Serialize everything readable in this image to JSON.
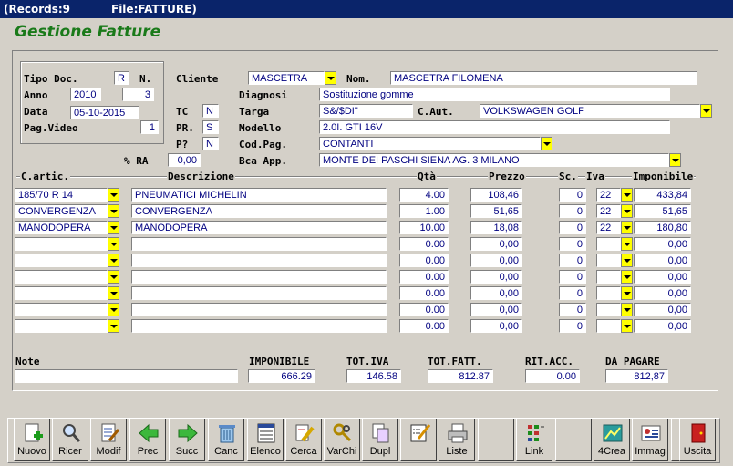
{
  "window": {
    "records": "(Records:9",
    "file": "File:FATTURE)"
  },
  "app_title": "Gestione Fatture",
  "header": {
    "tipo_doc_label": "Tipo Doc.",
    "tipo_doc": "R",
    "n_label": "N.",
    "anno_label": "Anno",
    "anno": "2010",
    "numero": "3",
    "data_label": "Data",
    "data": "05-10-2015",
    "pag_video_label": "Pag.Video",
    "pag_video": "1",
    "cliente_label": "Cliente",
    "cliente": "MASCETRA",
    "nom_label": "Nom.",
    "nominativo": "MASCETRA FILOMENA",
    "diagnosi_label": "Diagnosi",
    "diagnosi": "Sostituzione gomme",
    "tc_label": "TC",
    "tc": "N",
    "targa_label": "Targa",
    "targa": "S&/$DI\"",
    "caut_label": "C.Aut.",
    "caut": "VOLKSWAGEN GOLF",
    "pr_label": "PR.",
    "pr": "S",
    "modello_label": "Modello",
    "modello": "2.0I. GTI 16V",
    "p_label": "P?",
    "p": "N",
    "codpag_label": "Cod.Pag.",
    "codpag": "CONTANTI",
    "ra_label": "% RA",
    "ra": "0,00",
    "bca_label": "Bca App.",
    "bca": "MONTE DEI PASCHI SIENA  AG. 3  MILANO"
  },
  "columns": {
    "cartic": "C.artic.",
    "descr": "Descrizione",
    "qta": "Qtà",
    "prezzo": "Prezzo",
    "sc": "Sc.",
    "iva": "Iva",
    "imponibile": "Imponibile"
  },
  "rows": [
    {
      "cartic": "185/70 R  14",
      "descr": "PNEUMATICI MICHELIN",
      "qta": "4.00",
      "prezzo": "108,46",
      "sc": "0",
      "iva": "22",
      "imp": "433,84"
    },
    {
      "cartic": "CONVERGENZA",
      "descr": "CONVERGENZA",
      "qta": "1.00",
      "prezzo": "51,65",
      "sc": "0",
      "iva": "22",
      "imp": "51,65"
    },
    {
      "cartic": "MANODOPERA",
      "descr": "MANODOPERA",
      "qta": "10.00",
      "prezzo": "18,08",
      "sc": "0",
      "iva": "22",
      "imp": "180,80"
    },
    {
      "cartic": "",
      "descr": "",
      "qta": "0.00",
      "prezzo": "0,00",
      "sc": "0",
      "iva": "",
      "imp": "0,00"
    },
    {
      "cartic": "",
      "descr": "",
      "qta": "0.00",
      "prezzo": "0,00",
      "sc": "0",
      "iva": "",
      "imp": "0,00"
    },
    {
      "cartic": "",
      "descr": "",
      "qta": "0.00",
      "prezzo": "0,00",
      "sc": "0",
      "iva": "",
      "imp": "0,00"
    },
    {
      "cartic": "",
      "descr": "",
      "qta": "0.00",
      "prezzo": "0,00",
      "sc": "0",
      "iva": "",
      "imp": "0,00"
    },
    {
      "cartic": "",
      "descr": "",
      "qta": "0.00",
      "prezzo": "0,00",
      "sc": "0",
      "iva": "",
      "imp": "0,00"
    },
    {
      "cartic": "",
      "descr": "",
      "qta": "0.00",
      "prezzo": "0,00",
      "sc": "0",
      "iva": "",
      "imp": "0,00"
    }
  ],
  "totals": {
    "note_label": "Note",
    "note": "",
    "imponibile_label": "IMPONIBILE",
    "imponibile": "666.29",
    "totiva_label": "TOT.IVA",
    "totiva": "146.58",
    "totfatt_label": "TOT.FATT.",
    "totfatt": "812.87",
    "ritacc_label": "RIT.ACC.",
    "ritacc": "0.00",
    "dapagare_label": "DA PAGARE",
    "dapagare": "812,87"
  },
  "toolbar": [
    {
      "name": "nuovo",
      "label": "Nuovo",
      "icon": "new-doc-icon"
    },
    {
      "name": "ricer",
      "label": "Ricer",
      "icon": "magnifier-icon"
    },
    {
      "name": "modif",
      "label": "Modif",
      "icon": "edit-doc-icon"
    },
    {
      "name": "prec",
      "label": "Prec",
      "icon": "arrow-left-icon"
    },
    {
      "name": "succ",
      "label": "Succ",
      "icon": "arrow-right-icon"
    },
    {
      "name": "canc",
      "label": "Canc",
      "icon": "trash-icon"
    },
    {
      "name": "elenco",
      "label": "Elenco",
      "icon": "list-icon"
    },
    {
      "name": "cerca",
      "label": "Cerca",
      "icon": "search-brush-icon"
    },
    {
      "name": "varchi",
      "label": "VarChi",
      "icon": "keys-icon"
    },
    {
      "name": "dupl",
      "label": "Dupl",
      "icon": "duplicate-icon"
    },
    {
      "name": "pencil",
      "label": "",
      "icon": "pencil-doc-icon"
    },
    {
      "name": "liste",
      "label": "Liste",
      "icon": "printer-icon"
    },
    {
      "name": "blank1",
      "label": "",
      "icon": ""
    },
    {
      "name": "link",
      "label": "Link",
      "icon": "link-icon"
    },
    {
      "name": "blank2",
      "label": "",
      "icon": ""
    },
    {
      "name": "4crea",
      "label": "4Crea",
      "icon": "create-icon"
    },
    {
      "name": "immag",
      "label": "Immag",
      "icon": "image-icon"
    },
    {
      "name": "blank3",
      "label": "",
      "icon": ""
    },
    {
      "name": "uscita",
      "label": "Uscita",
      "icon": "exit-door-icon"
    }
  ],
  "colors": {
    "title_green": "#1a7a1a",
    "dropdown_yellow": "#ffff00",
    "text_navy": "#000080",
    "titlebar_blue": "#0a246a"
  }
}
